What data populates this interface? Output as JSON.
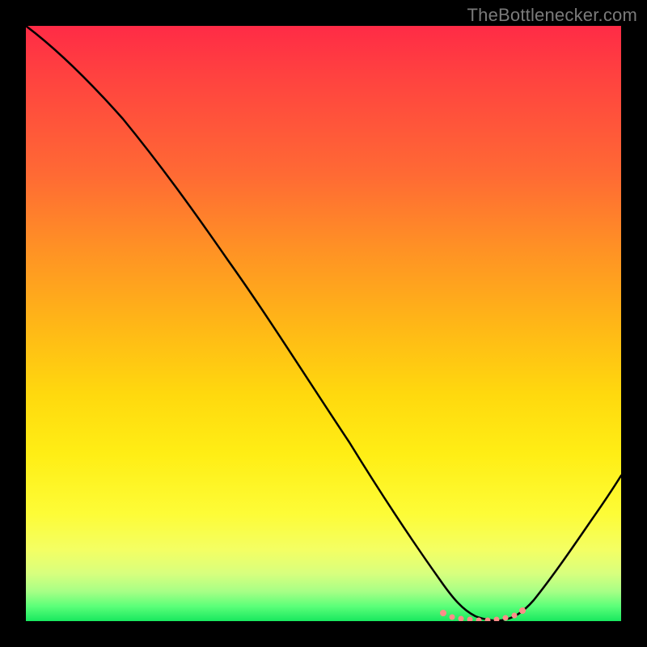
{
  "watermark": "TheBottlenecker.com",
  "chart_data": {
    "type": "line",
    "title": "",
    "xlabel": "",
    "ylabel": "",
    "xlim": [
      0,
      100
    ],
    "ylim": [
      0,
      100
    ],
    "background_gradient": {
      "top_color": "#ff2b46",
      "bottom_color": "#18e85f",
      "notes": "vertical rainbow gradient red→orange→yellow→green representing bottleneck severity (red high, green low)"
    },
    "series": [
      {
        "name": "bottleneck-curve",
        "color": "#000000",
        "x": [
          0,
          6,
          12,
          18,
          24,
          30,
          36,
          42,
          48,
          54,
          60,
          64,
          67,
          70,
          74,
          78,
          82,
          85,
          88,
          92,
          96,
          100
        ],
        "y": [
          100,
          95,
          89,
          82,
          74,
          66,
          58,
          49,
          40,
          31,
          22,
          14,
          8,
          3,
          1,
          0,
          0,
          1,
          3,
          9,
          18,
          28
        ]
      },
      {
        "name": "optimal-region-marker",
        "color": "#ff8d88",
        "style": "dotted",
        "x": [
          70,
          72,
          74,
          76,
          78,
          80,
          82,
          84,
          85
        ],
        "y": [
          3,
          1.8,
          1,
          0.5,
          0.2,
          0.2,
          0.5,
          0.9,
          1.2
        ]
      }
    ],
    "annotations": []
  }
}
